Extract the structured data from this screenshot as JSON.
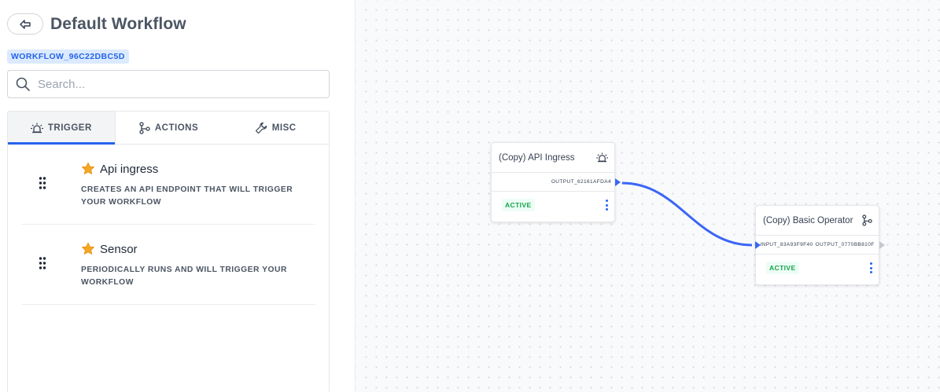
{
  "sidebar": {
    "title": "Default Workflow",
    "workflow_id": "WORKFLOW_96C22DBC5D",
    "search_placeholder": "Search...",
    "tabs": [
      {
        "label": "TRIGGER",
        "icon": "alarm-icon",
        "active": true
      },
      {
        "label": "ACTIONS",
        "icon": "branch-icon",
        "active": false
      },
      {
        "label": "MISC",
        "icon": "wrench-icon",
        "active": false
      }
    ],
    "items": [
      {
        "title": "Api ingress",
        "description": "CREATES AN API ENDPOINT THAT WILL TRIGGER YOUR WORKFLOW",
        "icon": "star-icon"
      },
      {
        "title": "Sensor",
        "description": "PERIODICALLY RUNS AND WILL TRIGGER YOUR WORKFLOW",
        "icon": "star-icon"
      }
    ]
  },
  "canvas": {
    "nodes": [
      {
        "title": "(Copy) API Ingress",
        "icon": "alarm-icon",
        "output": "OUTPUT_62161AFDA4",
        "status": "ACTIVE"
      },
      {
        "title": "(Copy) Basic Operator",
        "icon": "branch-icon",
        "input": "INPUT_83A93F9F40",
        "output": "OUTPUT_0770BB810F",
        "status": "ACTIVE"
      }
    ]
  },
  "colors": {
    "accent": "#2563eb",
    "edge": "#3b66f5",
    "badge_bg": "#dbeafe",
    "status_green": "#16a34a",
    "star": "#f59e0b"
  }
}
